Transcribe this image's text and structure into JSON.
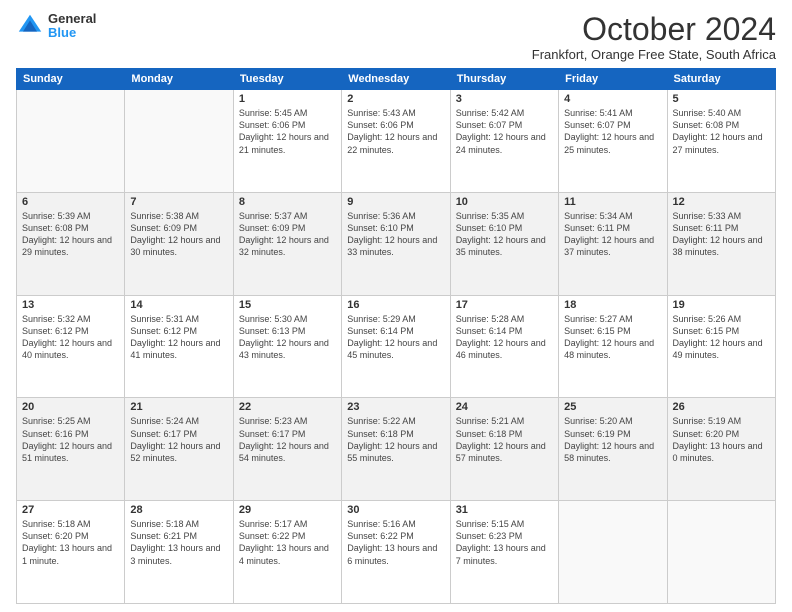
{
  "header": {
    "logo_general": "General",
    "logo_blue": "Blue",
    "month": "October 2024",
    "location": "Frankfort, Orange Free State, South Africa"
  },
  "days_of_week": [
    "Sunday",
    "Monday",
    "Tuesday",
    "Wednesday",
    "Thursday",
    "Friday",
    "Saturday"
  ],
  "weeks": [
    [
      {
        "day": "",
        "info": ""
      },
      {
        "day": "",
        "info": ""
      },
      {
        "day": "1",
        "info": "Sunrise: 5:45 AM\nSunset: 6:06 PM\nDaylight: 12 hours and 21 minutes."
      },
      {
        "day": "2",
        "info": "Sunrise: 5:43 AM\nSunset: 6:06 PM\nDaylight: 12 hours and 22 minutes."
      },
      {
        "day": "3",
        "info": "Sunrise: 5:42 AM\nSunset: 6:07 PM\nDaylight: 12 hours and 24 minutes."
      },
      {
        "day": "4",
        "info": "Sunrise: 5:41 AM\nSunset: 6:07 PM\nDaylight: 12 hours and 25 minutes."
      },
      {
        "day": "5",
        "info": "Sunrise: 5:40 AM\nSunset: 6:08 PM\nDaylight: 12 hours and 27 minutes."
      }
    ],
    [
      {
        "day": "6",
        "info": "Sunrise: 5:39 AM\nSunset: 6:08 PM\nDaylight: 12 hours and 29 minutes."
      },
      {
        "day": "7",
        "info": "Sunrise: 5:38 AM\nSunset: 6:09 PM\nDaylight: 12 hours and 30 minutes."
      },
      {
        "day": "8",
        "info": "Sunrise: 5:37 AM\nSunset: 6:09 PM\nDaylight: 12 hours and 32 minutes."
      },
      {
        "day": "9",
        "info": "Sunrise: 5:36 AM\nSunset: 6:10 PM\nDaylight: 12 hours and 33 minutes."
      },
      {
        "day": "10",
        "info": "Sunrise: 5:35 AM\nSunset: 6:10 PM\nDaylight: 12 hours and 35 minutes."
      },
      {
        "day": "11",
        "info": "Sunrise: 5:34 AM\nSunset: 6:11 PM\nDaylight: 12 hours and 37 minutes."
      },
      {
        "day": "12",
        "info": "Sunrise: 5:33 AM\nSunset: 6:11 PM\nDaylight: 12 hours and 38 minutes."
      }
    ],
    [
      {
        "day": "13",
        "info": "Sunrise: 5:32 AM\nSunset: 6:12 PM\nDaylight: 12 hours and 40 minutes."
      },
      {
        "day": "14",
        "info": "Sunrise: 5:31 AM\nSunset: 6:12 PM\nDaylight: 12 hours and 41 minutes."
      },
      {
        "day": "15",
        "info": "Sunrise: 5:30 AM\nSunset: 6:13 PM\nDaylight: 12 hours and 43 minutes."
      },
      {
        "day": "16",
        "info": "Sunrise: 5:29 AM\nSunset: 6:14 PM\nDaylight: 12 hours and 45 minutes."
      },
      {
        "day": "17",
        "info": "Sunrise: 5:28 AM\nSunset: 6:14 PM\nDaylight: 12 hours and 46 minutes."
      },
      {
        "day": "18",
        "info": "Sunrise: 5:27 AM\nSunset: 6:15 PM\nDaylight: 12 hours and 48 minutes."
      },
      {
        "day": "19",
        "info": "Sunrise: 5:26 AM\nSunset: 6:15 PM\nDaylight: 12 hours and 49 minutes."
      }
    ],
    [
      {
        "day": "20",
        "info": "Sunrise: 5:25 AM\nSunset: 6:16 PM\nDaylight: 12 hours and 51 minutes."
      },
      {
        "day": "21",
        "info": "Sunrise: 5:24 AM\nSunset: 6:17 PM\nDaylight: 12 hours and 52 minutes."
      },
      {
        "day": "22",
        "info": "Sunrise: 5:23 AM\nSunset: 6:17 PM\nDaylight: 12 hours and 54 minutes."
      },
      {
        "day": "23",
        "info": "Sunrise: 5:22 AM\nSunset: 6:18 PM\nDaylight: 12 hours and 55 minutes."
      },
      {
        "day": "24",
        "info": "Sunrise: 5:21 AM\nSunset: 6:18 PM\nDaylight: 12 hours and 57 minutes."
      },
      {
        "day": "25",
        "info": "Sunrise: 5:20 AM\nSunset: 6:19 PM\nDaylight: 12 hours and 58 minutes."
      },
      {
        "day": "26",
        "info": "Sunrise: 5:19 AM\nSunset: 6:20 PM\nDaylight: 13 hours and 0 minutes."
      }
    ],
    [
      {
        "day": "27",
        "info": "Sunrise: 5:18 AM\nSunset: 6:20 PM\nDaylight: 13 hours and 1 minute."
      },
      {
        "day": "28",
        "info": "Sunrise: 5:18 AM\nSunset: 6:21 PM\nDaylight: 13 hours and 3 minutes."
      },
      {
        "day": "29",
        "info": "Sunrise: 5:17 AM\nSunset: 6:22 PM\nDaylight: 13 hours and 4 minutes."
      },
      {
        "day": "30",
        "info": "Sunrise: 5:16 AM\nSunset: 6:22 PM\nDaylight: 13 hours and 6 minutes."
      },
      {
        "day": "31",
        "info": "Sunrise: 5:15 AM\nSunset: 6:23 PM\nDaylight: 13 hours and 7 minutes."
      },
      {
        "day": "",
        "info": ""
      },
      {
        "day": "",
        "info": ""
      }
    ]
  ]
}
